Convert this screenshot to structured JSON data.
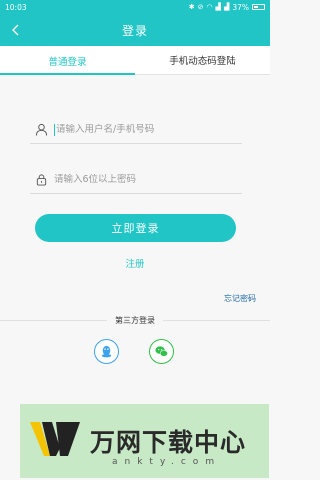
{
  "status_bar": {
    "time": "10:03",
    "battery": "37%"
  },
  "header": {
    "title": "登录"
  },
  "tabs": [
    {
      "label": "普通登录",
      "active": true
    },
    {
      "label": "手机动态码登陆",
      "active": false
    }
  ],
  "form": {
    "username_placeholder": "请输入用户名/手机号码",
    "password_placeholder": "请输入6位以上密码",
    "login_button": "立即登录",
    "register_link": "注册",
    "forgot_link": "忘记密码"
  },
  "third_party": {
    "label": "第三方登录",
    "providers": [
      "qq",
      "wechat"
    ]
  },
  "watermark": {
    "text": "万网下载中心",
    "sub": "ankty.com"
  },
  "colors": {
    "accent": "#22c5c6",
    "link": "#1f6aa5",
    "qq": "#3da2f0",
    "wechat": "#30bf48"
  }
}
